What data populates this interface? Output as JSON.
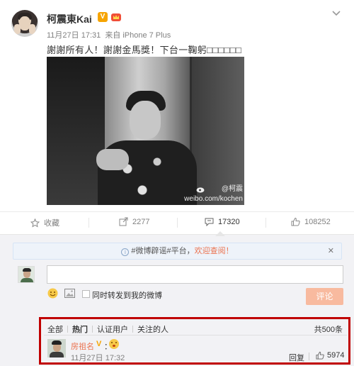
{
  "post": {
    "author": "柯震東Kai",
    "verified_badge": "V",
    "timestamp": "11月27日 17:31",
    "source_prefix": "来自",
    "source": "iPhone 7 Plus",
    "text": "謝謝所有人！謝謝金馬獎！下台一鞠躬□□□□□□",
    "image": {
      "watermark_name": "@柯震",
      "watermark_url": "weibo.com/kochen"
    }
  },
  "actions": {
    "favorite_label": "收藏",
    "repost_count": "2277",
    "comment_count": "17320",
    "like_count": "108252"
  },
  "comment_box": {
    "notice_prefix": "#微博辟谣#平台，",
    "notice_highlight": "欢迎查阅！",
    "notice_close": "✕",
    "input_placeholder": "",
    "also_repost_label": "同时转发到我的微博",
    "submit_label": "评论"
  },
  "comments": {
    "filters": [
      "全部",
      "热门",
      "认证用户",
      "关注的人"
    ],
    "active_filter": "热门",
    "total": "共500条",
    "items": [
      {
        "name": "房祖名",
        "badge": "V",
        "colon": "：",
        "time": "11月27日 17:32",
        "reply_label": "回复",
        "likes": "5974"
      }
    ]
  },
  "colors": {
    "accent": "#eb7350",
    "verified": "#f6a400",
    "highlight_box": "#c00000"
  }
}
